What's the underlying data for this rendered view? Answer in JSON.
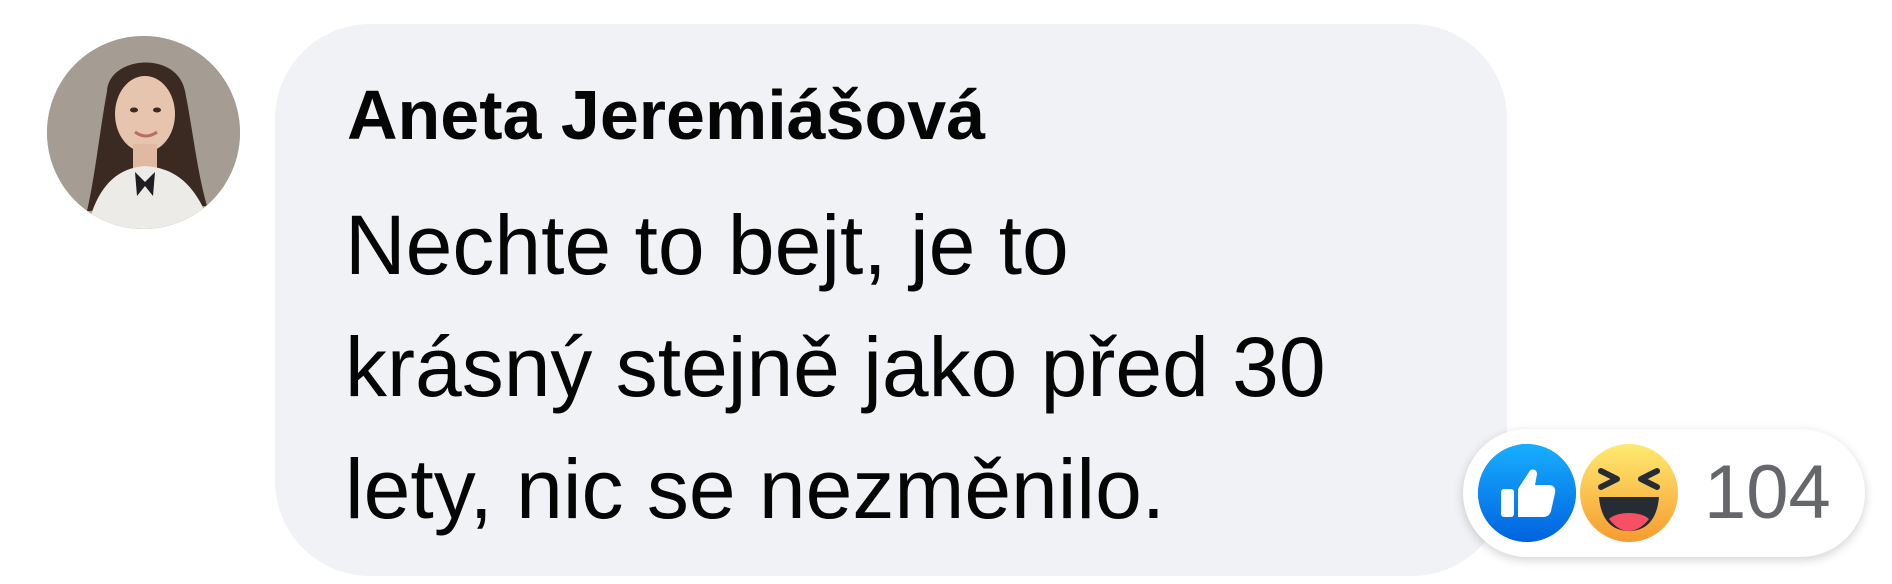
{
  "comment": {
    "author": "Aneta Jeremiášová",
    "text_lines": [
      "Nechte to bejt, je to",
      "krásný stejně jako před 30",
      "lety, nic se nezměnilo."
    ],
    "avatar_icon": "profile-photo"
  },
  "reactions": {
    "icons": [
      "like-icon",
      "haha-icon"
    ],
    "count": "104",
    "colors": {
      "like": "#1877f2",
      "haha": "#f7b125"
    }
  },
  "colors": {
    "bubble": "#f0f2f5",
    "text": "#050505",
    "count_text": "#65676b"
  }
}
